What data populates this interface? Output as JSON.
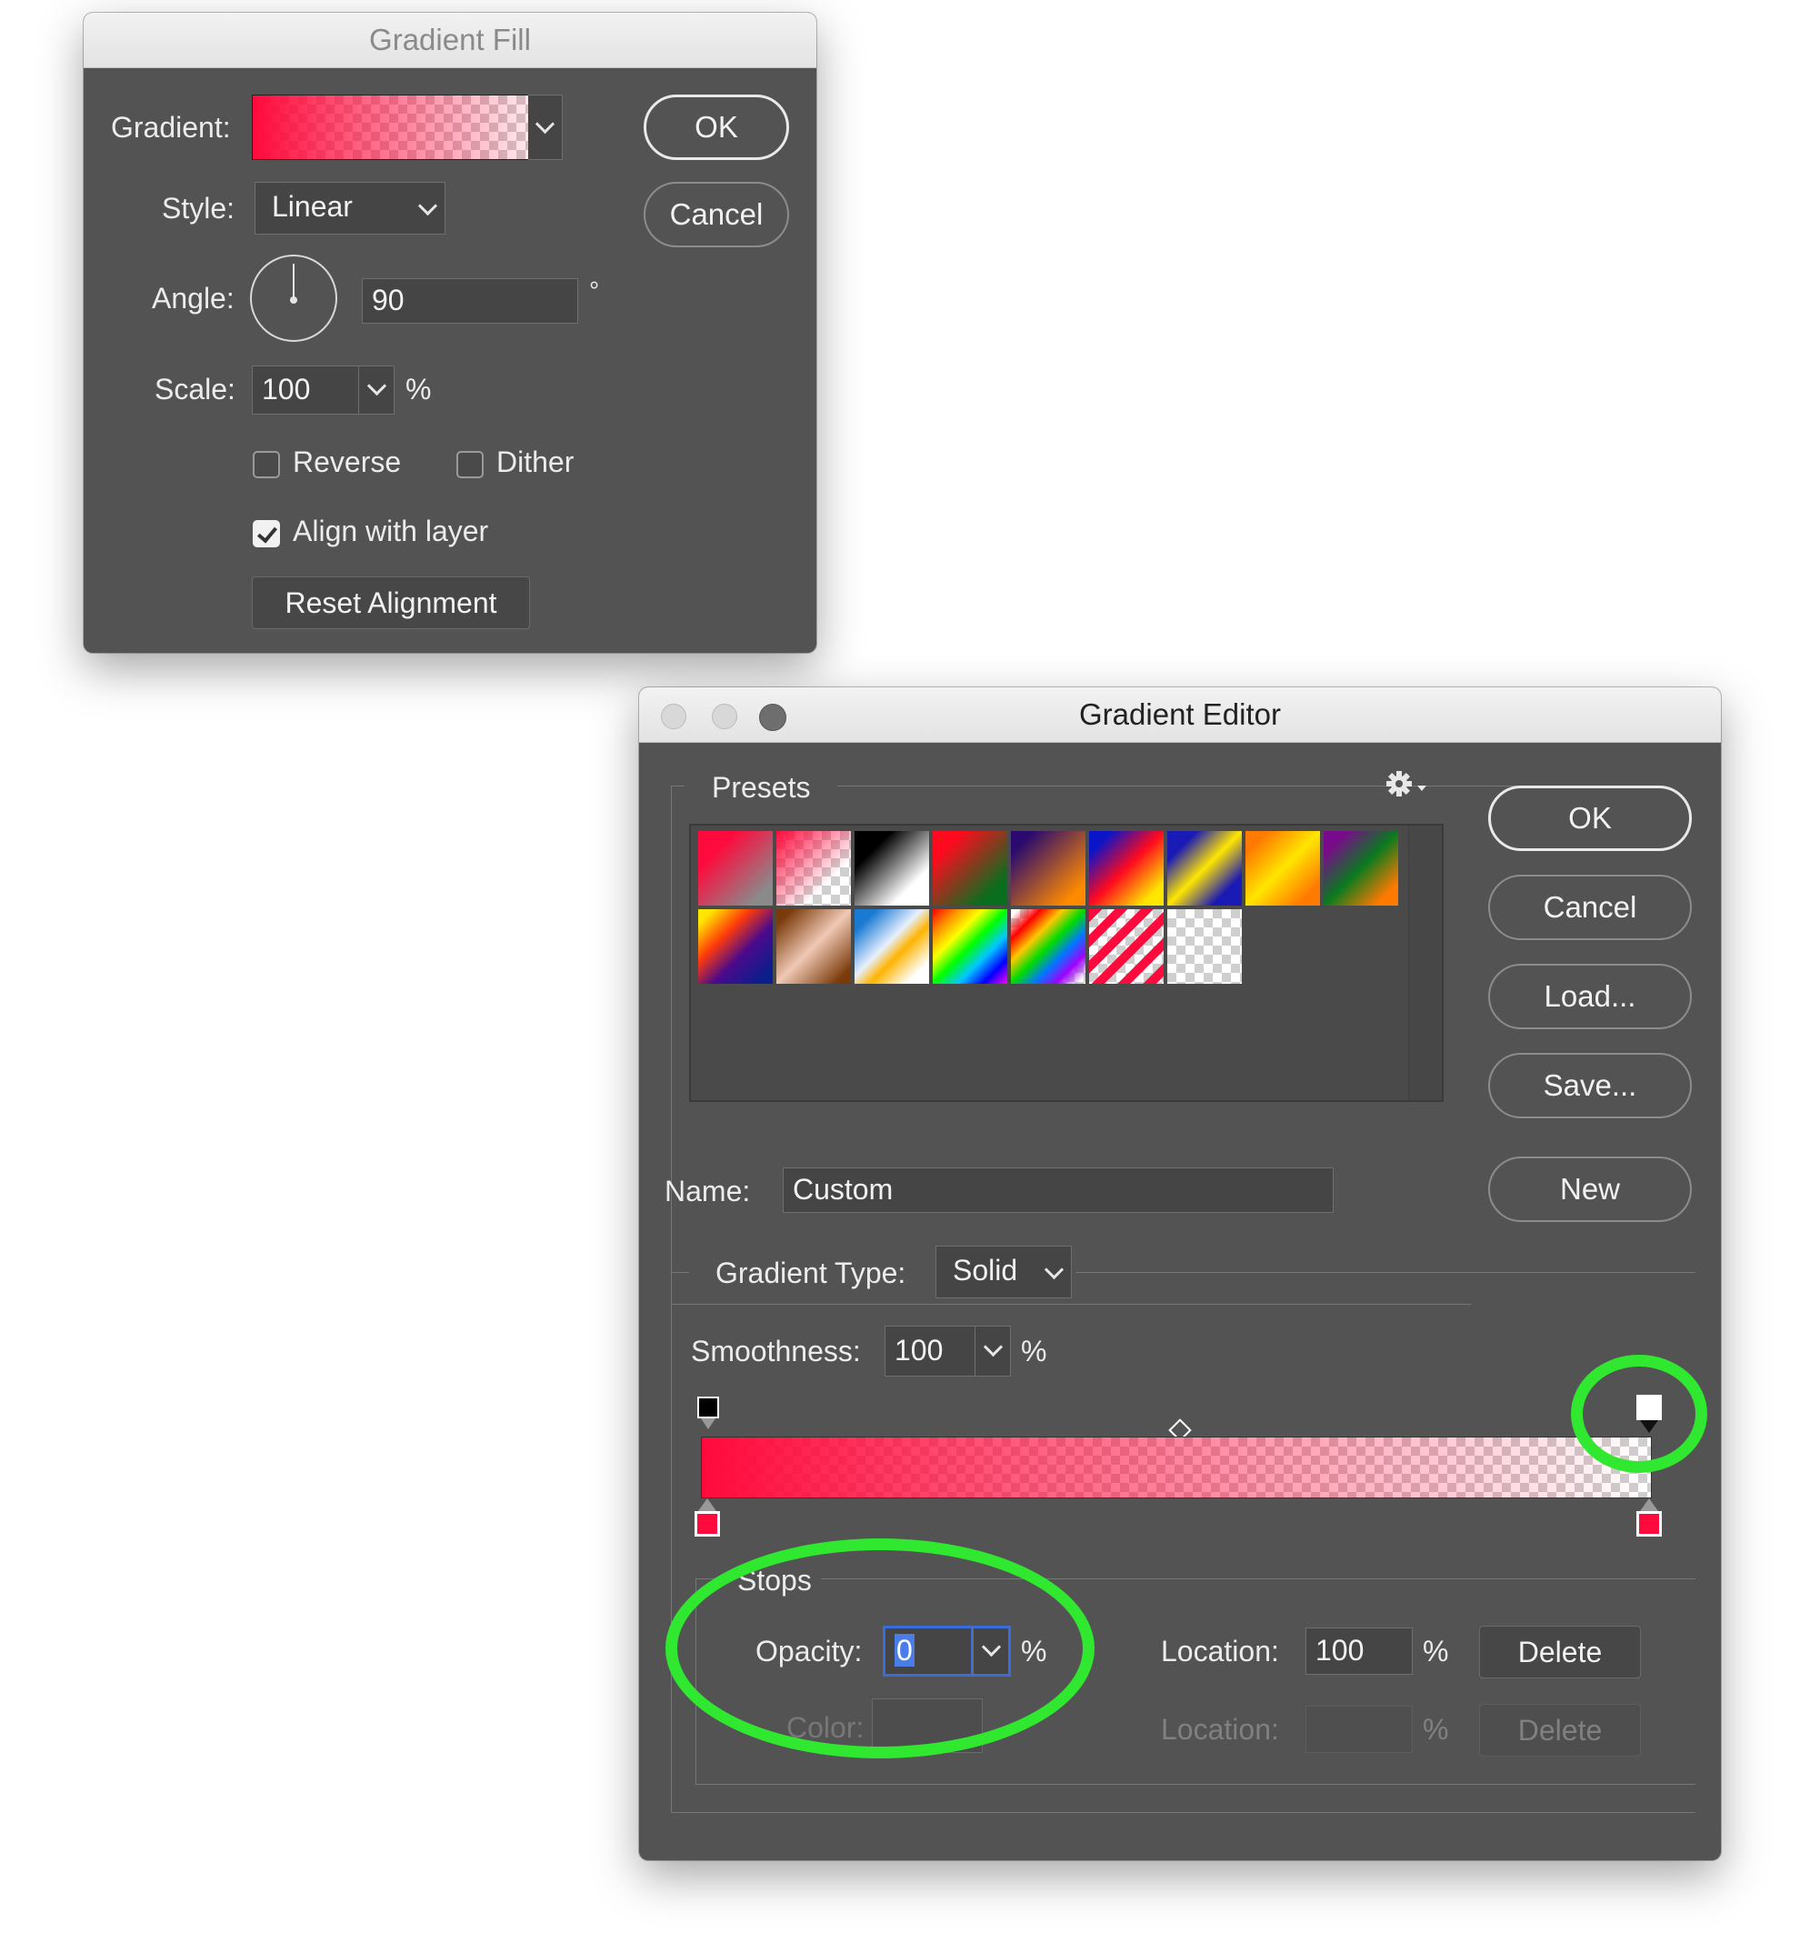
{
  "gradient_fill": {
    "title": "Gradient Fill",
    "gradient_label": "Gradient:",
    "style_label": "Style:",
    "style_value": "Linear",
    "angle_label": "Angle:",
    "angle_value": "90",
    "degree_symbol": "°",
    "scale_label": "Scale:",
    "scale_value": "100",
    "percent": "%",
    "reverse_label": "Reverse",
    "reverse_checked": false,
    "dither_label": "Dither",
    "dither_checked": false,
    "align_label": "Align with layer",
    "align_checked": true,
    "reset_label": "Reset Alignment",
    "ok_label": "OK",
    "cancel_label": "Cancel"
  },
  "gradient_editor": {
    "title": "Gradient Editor",
    "presets_label": "Presets",
    "ok_label": "OK",
    "cancel_label": "Cancel",
    "load_label": "Load...",
    "save_label": "Save...",
    "new_label": "New",
    "name_label": "Name:",
    "name_value": "Custom",
    "gradient_type_label": "Gradient Type:",
    "gradient_type_value": "Solid",
    "smoothness_label": "Smoothness:",
    "smoothness_value": "100",
    "percent": "%",
    "stops_label": "Stops",
    "opacity_label": "Opacity:",
    "opacity_value": "0",
    "location_label": "Location:",
    "location_value": "100",
    "delete_label": "Delete",
    "color_label": "Color:",
    "location2_label": "Location:",
    "delete2_label": "Delete",
    "opacity_stop_start": 0,
    "opacity_stop_end": 100,
    "color_stop_start": 0,
    "color_stop_end": 100,
    "midpoint": 50
  },
  "colors": {
    "accent_red": "#ff0a3c",
    "highlight_green": "#2fe82f",
    "dialog_bg": "#535353"
  },
  "icons": [
    "gear-icon",
    "chevron-down-icon",
    "checkmark-icon",
    "angle-dial-icon"
  ]
}
